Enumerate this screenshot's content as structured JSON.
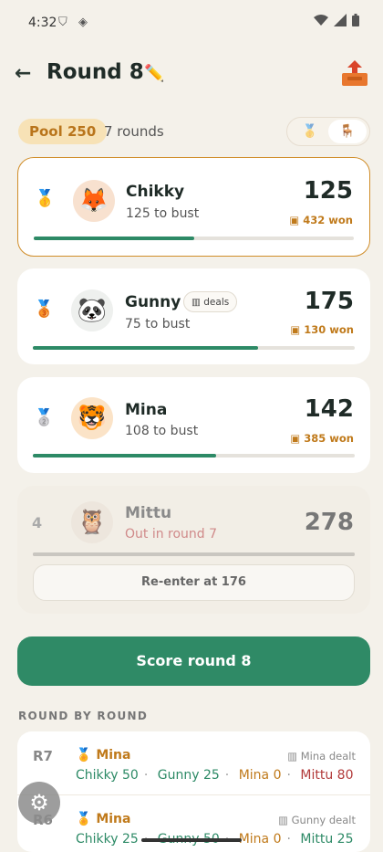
{
  "status": {
    "time": "4:32",
    "icons": [
      "shield-icon",
      "dice-icon",
      "wifi-icon",
      "signal-icon",
      "battery-icon"
    ]
  },
  "header": {
    "title": "Round 8",
    "icons": [
      "back-arrow-icon",
      "pencil-icon",
      "export-tray-icon"
    ]
  },
  "pool": {
    "chip": "Pool 250",
    "rounds": "7 rounds"
  },
  "view_toggle": {
    "options": [
      "medal-icon",
      "chair-icon"
    ],
    "selected": "chair-icon"
  },
  "players": [
    {
      "rank_icon": "gold-medal-icon",
      "name": "Chikky",
      "to_bust": "125 to bust",
      "score": "125",
      "won": "432 won",
      "avatar_icon": "fox-icon",
      "progress": 0.5,
      "active": true
    },
    {
      "rank_icon": "bronze-medal-icon",
      "name": "Gunny",
      "badge": "deals",
      "to_bust": "75 to bust",
      "score": "175",
      "won": "130 won",
      "avatar_icon": "panda-icon",
      "progress": 0.7
    },
    {
      "rank_icon": "silver-medal-icon",
      "name": "Mina",
      "to_bust": "108 to bust",
      "score": "142",
      "won": "385 won",
      "avatar_icon": "tiger-icon",
      "progress": 0.57
    },
    {
      "rank": "4",
      "name": "Mittu",
      "status": "Out in round 7",
      "score": "278",
      "avatar_icon": "owl-icon",
      "progress": 1.0,
      "reenter_label": "Re-enter at 176"
    }
  ],
  "score_button": "Score round 8",
  "history": {
    "title": "ROUND BY ROUND",
    "rounds": [
      {
        "label": "R7",
        "winner": "Mina",
        "dealt": "Mina dealt",
        "scores": [
          {
            "name": "Chikky",
            "value": "50",
            "tone": "green"
          },
          {
            "name": "Gunny",
            "value": "25",
            "tone": "green"
          },
          {
            "name": "Mina",
            "value": "0",
            "tone": "gold"
          },
          {
            "name": "Mittu",
            "value": "80",
            "tone": "red"
          }
        ]
      },
      {
        "label": "R6",
        "winner": "Mina",
        "dealt": "Gunny dealt",
        "scores": [
          {
            "name": "Chikky",
            "value": "25",
            "tone": "green"
          },
          {
            "name": "Gunny",
            "value": "50",
            "tone": "green"
          },
          {
            "name": "Mina",
            "value": "0",
            "tone": "gold"
          },
          {
            "name": "Mittu",
            "value": "25",
            "tone": "green"
          }
        ]
      }
    ]
  },
  "colors": {
    "accent": "#2f8a66",
    "gold": "#c07a1b",
    "danger": "#b23a3a",
    "background": "#f4f1ea"
  }
}
